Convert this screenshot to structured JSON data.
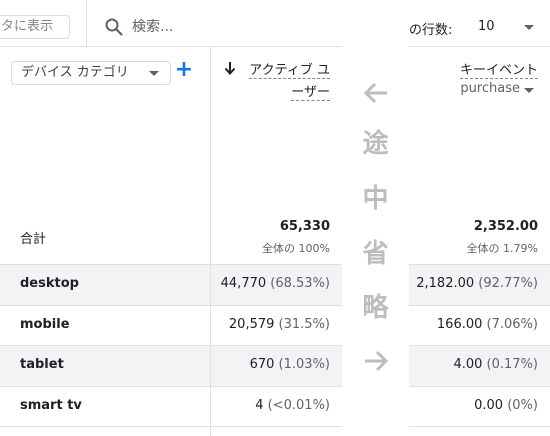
{
  "toolbar": {
    "show_in_table_text": "タに表示",
    "search_placeholder": "検索...",
    "rows_label": "の行数:",
    "rows_value": "10"
  },
  "dimension": {
    "selected": "デバイス カテゴリ",
    "add_label": "+"
  },
  "columns": {
    "active_users_line1": "アクティブ ユ",
    "active_users_line2": "ーザー",
    "key_event_label": "キーイベント",
    "key_event_selected": "purchase"
  },
  "totals": {
    "label": "合計",
    "active_users": "65,330",
    "active_users_share": "全体の 100%",
    "key_events": "2,352.00",
    "key_events_share": "全体の 1.79%"
  },
  "rows": [
    {
      "dim": "desktop",
      "users": "44,770",
      "users_pct": "(68.53%)",
      "events": "2,182.00",
      "events_pct": "(92.77%)"
    },
    {
      "dim": "mobile",
      "users": "20,579",
      "users_pct": "(31.5%)",
      "events": "166.00",
      "events_pct": "(7.06%)"
    },
    {
      "dim": "tablet",
      "users": "670",
      "users_pct": "(1.03%)",
      "events": "4.00",
      "events_pct": "(0.17%)"
    },
    {
      "dim": "smart tv",
      "users": "4",
      "users_pct": "(<0.01%)",
      "events": "0.00",
      "events_pct": "(0%)"
    }
  ],
  "omission": {
    "left_arrow": "←",
    "chars": [
      "途",
      "中",
      "省",
      "略"
    ],
    "right_arrow": "→"
  }
}
